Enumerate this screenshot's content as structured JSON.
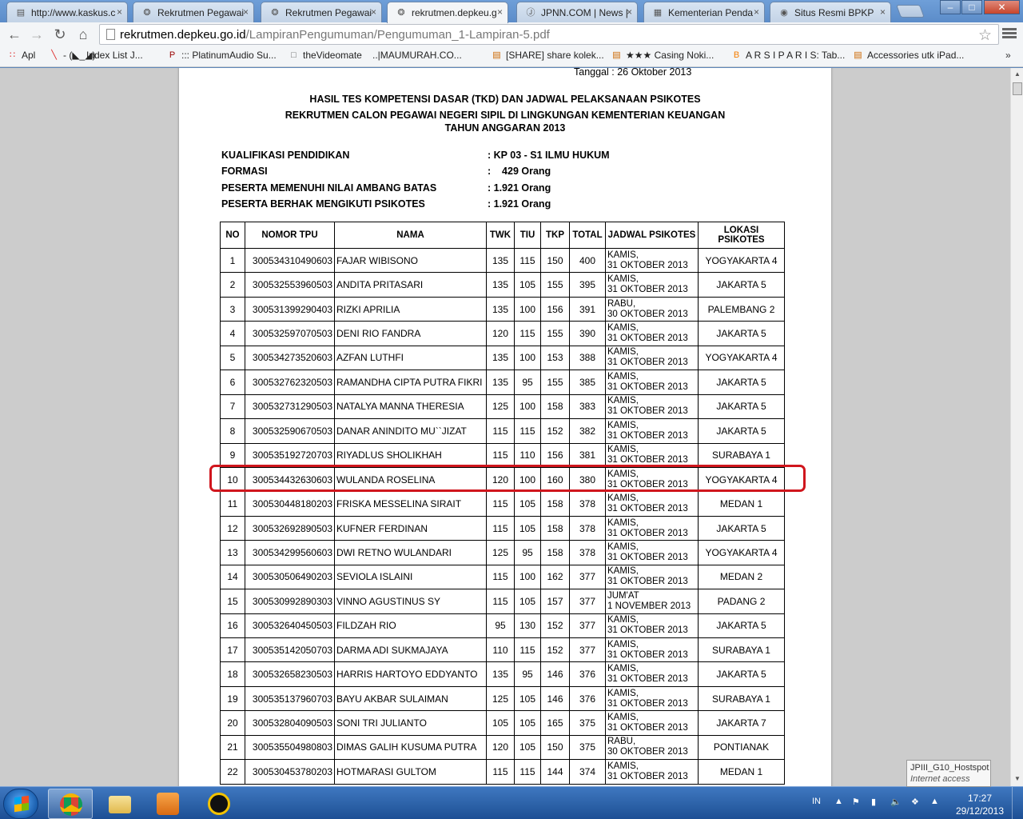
{
  "browser": {
    "tabs": [
      {
        "title": "http://www.kaskus.c",
        "icon": "kaskus-icon"
      },
      {
        "title": "Rekrutmen Pegawai",
        "icon": "kemenkeu-icon"
      },
      {
        "title": "Rekrutmen Pegawai",
        "icon": "kemenkeu-icon"
      },
      {
        "title": "rekrutmen.depkeu.g",
        "icon": "kemenkeu-icon"
      },
      {
        "title": "JPNN.COM | News |",
        "icon": "jpnn-icon"
      },
      {
        "title": "Kementerian Penda",
        "icon": "document-icon"
      },
      {
        "title": "Situs Resmi BPKP",
        "icon": "bpkp-icon"
      }
    ],
    "url_host": "rekrutmen.depkeu.go.id",
    "url_path": "/LampiranPengumuman/Pengumuman_1-Lampiran-5.pdf",
    "bookmarks": [
      {
        "label": "Apl",
        "icon": "apps-grid-icon"
      },
      {
        "label": "- (◣_◢)",
        "icon": "red-pen-icon"
      },
      {
        "label": "Index List J...",
        "icon": ""
      },
      {
        "label": "::: PlatinumAudio Su...",
        "icon": "platinum-icon"
      },
      {
        "label": "theVideomate",
        "icon": "page-icon"
      },
      {
        "label": "..|MAUMURAH.CO...",
        "icon": ""
      },
      {
        "label": "[SHARE] share kolek...",
        "icon": "kaskus-icon"
      },
      {
        "label": "★★★ Casing Noki...",
        "icon": "kaskus-icon"
      },
      {
        "label": "A R S I P A R I S: Tab...",
        "icon": "blogger-icon"
      },
      {
        "label": "Accessories utk iPad...",
        "icon": "kaskus-icon"
      }
    ],
    "bookmarks_more": "»"
  },
  "document": {
    "date_line": "Tanggal :  26 Oktober 2013",
    "title_1": "HASIL TES KOMPETENSI DASAR (TKD) DAN JADWAL PELAKSANAAN PSIKOTES",
    "title_2": "REKRUTMEN CALON PEGAWAI NEGERI SIPIL DI LINGKUNGAN KEMENTERIAN KEUANGAN",
    "title_3": "TAHUN ANGGARAN 2013",
    "info": [
      {
        "key": "KUALIFIKASI PENDIDIKAN",
        "value": ": KP 03 - S1 ILMU HUKUM"
      },
      {
        "key": "FORMASI",
        "value": ":    429 Orang"
      },
      {
        "key": "PESERTA MEMENUHI NILAI AMBANG BATAS",
        "value": ": 1.921 Orang"
      },
      {
        "key": "PESERTA BERHAK MENGIKUTI PSIKOTES",
        "value": ": 1.921 Orang"
      }
    ],
    "table": {
      "headers": [
        "NO",
        "NOMOR TPU",
        "NAMA",
        "TWK",
        "TIU",
        "TKP",
        "TOTAL",
        "JADWAL PSIKOTES",
        "LOKASI PSIKOTES"
      ],
      "rows": [
        [
          "1",
          "300534310490603",
          "FAJAR WIBISONO",
          "135",
          "115",
          "150",
          "400",
          "KAMIS,",
          "31 OKTOBER 2013",
          "YOGYAKARTA 4"
        ],
        [
          "2",
          "300532553960503",
          "ANDITA PRITASARI",
          "135",
          "105",
          "155",
          "395",
          "KAMIS,",
          "31 OKTOBER 2013",
          "JAKARTA 5"
        ],
        [
          "3",
          "300531399290403",
          "RIZKI APRILIA",
          "135",
          "100",
          "156",
          "391",
          "RABU,",
          "30 OKTOBER 2013",
          "PALEMBANG 2"
        ],
        [
          "4",
          "300532597070503",
          "DENI RIO FANDRA",
          "120",
          "115",
          "155",
          "390",
          "KAMIS,",
          "31 OKTOBER 2013",
          "JAKARTA 5"
        ],
        [
          "5",
          "300534273520603",
          "AZFAN LUTHFI",
          "135",
          "100",
          "153",
          "388",
          "KAMIS,",
          "31 OKTOBER 2013",
          "YOGYAKARTA 4"
        ],
        [
          "6",
          "300532762320503",
          "RAMANDHA CIPTA PUTRA FIKRI",
          "135",
          "95",
          "155",
          "385",
          "KAMIS,",
          "31 OKTOBER 2013",
          "JAKARTA 5"
        ],
        [
          "7",
          "300532731290503",
          "NATALYA MANNA THERESIA",
          "125",
          "100",
          "158",
          "383",
          "KAMIS,",
          "31 OKTOBER 2013",
          "JAKARTA 5"
        ],
        [
          "8",
          "300532590670503",
          "DANAR ANINDITO MU``JIZAT",
          "115",
          "115",
          "152",
          "382",
          "KAMIS,",
          "31 OKTOBER 2013",
          "JAKARTA 5"
        ],
        [
          "9",
          "300535192720703",
          "RIYADLUS SHOLIKHAH",
          "115",
          "110",
          "156",
          "381",
          "KAMIS,",
          "31 OKTOBER 2013",
          "SURABAYA 1"
        ],
        [
          "10",
          "300534432630603",
          "WULANDA ROSELINA",
          "120",
          "100",
          "160",
          "380",
          "KAMIS,",
          "31 OKTOBER 2013",
          "YOGYAKARTA 4"
        ],
        [
          "11",
          "300530448180203",
          "FRISKA MESSELINA SIRAIT",
          "115",
          "105",
          "158",
          "378",
          "KAMIS,",
          "31 OKTOBER 2013",
          "MEDAN 1"
        ],
        [
          "12",
          "300532692890503",
          "KUFNER FERDINAN",
          "115",
          "105",
          "158",
          "378",
          "KAMIS,",
          "31 OKTOBER 2013",
          "JAKARTA 5"
        ],
        [
          "13",
          "300534299560603",
          "DWI RETNO WULANDARI",
          "125",
          "95",
          "158",
          "378",
          "KAMIS,",
          "31 OKTOBER 2013",
          "YOGYAKARTA 4"
        ],
        [
          "14",
          "300530506490203",
          "SEVIOLA ISLAINI",
          "115",
          "100",
          "162",
          "377",
          "KAMIS,",
          "31 OKTOBER 2013",
          "MEDAN 2"
        ],
        [
          "15",
          "300530992890303",
          "VINNO AGUSTINUS SY",
          "115",
          "105",
          "157",
          "377",
          "JUM'AT",
          "1 NOVEMBER 2013",
          "PADANG 2"
        ],
        [
          "16",
          "300532640450503",
          "FILDZAH RIO",
          "95",
          "130",
          "152",
          "377",
          "KAMIS,",
          "31 OKTOBER 2013",
          "JAKARTA 5"
        ],
        [
          "17",
          "300535142050703",
          "DARMA ADI SUKMAJAYA",
          "110",
          "115",
          "152",
          "377",
          "KAMIS,",
          "31 OKTOBER 2013",
          "SURABAYA 1"
        ],
        [
          "18",
          "300532658230503",
          "HARRIS HARTOYO EDDYANTO",
          "135",
          "95",
          "146",
          "376",
          "KAMIS,",
          "31 OKTOBER 2013",
          "JAKARTA 5"
        ],
        [
          "19",
          "300535137960703",
          "BAYU AKBAR SULAIMAN",
          "125",
          "105",
          "146",
          "376",
          "KAMIS,",
          "31 OKTOBER 2013",
          "SURABAYA 1"
        ],
        [
          "20",
          "300532804090503",
          "SONI TRI JULIANTO",
          "105",
          "105",
          "165",
          "375",
          "KAMIS,",
          "31 OKTOBER 2013",
          "JAKARTA 7"
        ],
        [
          "21",
          "300535504980803",
          "DIMAS GALIH KUSUMA PUTRA",
          "120",
          "105",
          "150",
          "375",
          "RABU,",
          "30 OKTOBER 2013",
          "PONTIANAK"
        ],
        [
          "22",
          "300530453780203",
          "HOTMARASI GULTOM",
          "115",
          "115",
          "144",
          "374",
          "KAMIS,",
          "31 OKTOBER 2013",
          "MEDAN 1"
        ]
      ],
      "highlighted_row_no": "10",
      "highlight_color": "#d0161d"
    }
  },
  "tooltip": {
    "line1": "JPIII_G10_Hostspot",
    "line2": "Internet access"
  },
  "taskbar": {
    "language": "IN",
    "time": "17:27",
    "date": "29/12/2013",
    "apps": [
      "chrome-icon",
      "folder-icon",
      "media-player-icon",
      "app-icon"
    ]
  }
}
